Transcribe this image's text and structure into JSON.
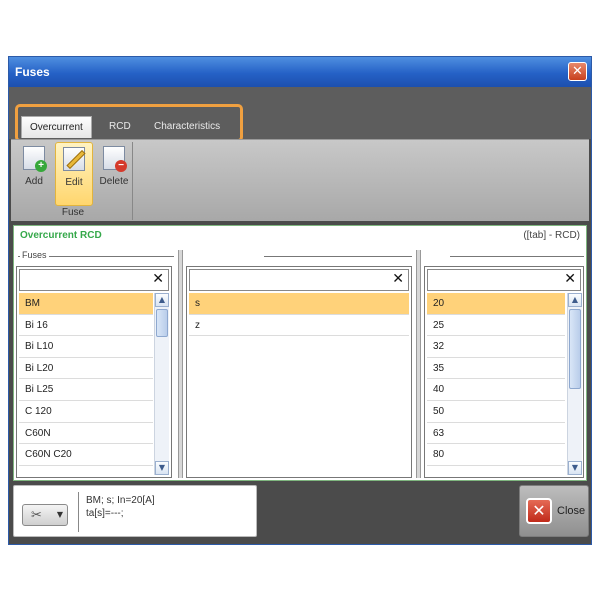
{
  "window": {
    "title": "Fuses",
    "close_glyph": "✕"
  },
  "ribbon": {
    "tabs": [
      {
        "label": "Overcurrent",
        "active": true
      },
      {
        "label": "RCD",
        "active": false
      },
      {
        "label": "Characteristics",
        "active": false
      }
    ],
    "group_label": "Fuse",
    "buttons": {
      "add": "Add",
      "edit": "Edit",
      "delete": "Delete"
    }
  },
  "panel": {
    "title": "Overcurrent RCD",
    "hint": "([tab] - RCD)",
    "fuses": {
      "legend": "Fuses",
      "search_value": "",
      "clear_glyph": "✕",
      "items": [
        "BM",
        "Bi 16",
        "Bi L10",
        "Bi L20",
        "Bi L25",
        "C 120",
        "C60N",
        "C60N C20"
      ],
      "selected": "BM"
    },
    "characteristics": {
      "search_value": "",
      "clear_glyph": "✕",
      "items": [
        "s",
        "z"
      ],
      "selected": "s"
    },
    "ratings": {
      "search_value": "",
      "clear_glyph": "✕",
      "items": [
        "20",
        "25",
        "32",
        "35",
        "40",
        "50",
        "63",
        "80"
      ],
      "selected": "20"
    }
  },
  "footer": {
    "info_line1": "BM; s; In=20[A]",
    "info_line2": "ta[s]=---;",
    "close_label": "Close"
  },
  "colors": {
    "accent_outline": "#f0a040",
    "panel_title": "#35a84a",
    "selection": "#ffd27a"
  }
}
